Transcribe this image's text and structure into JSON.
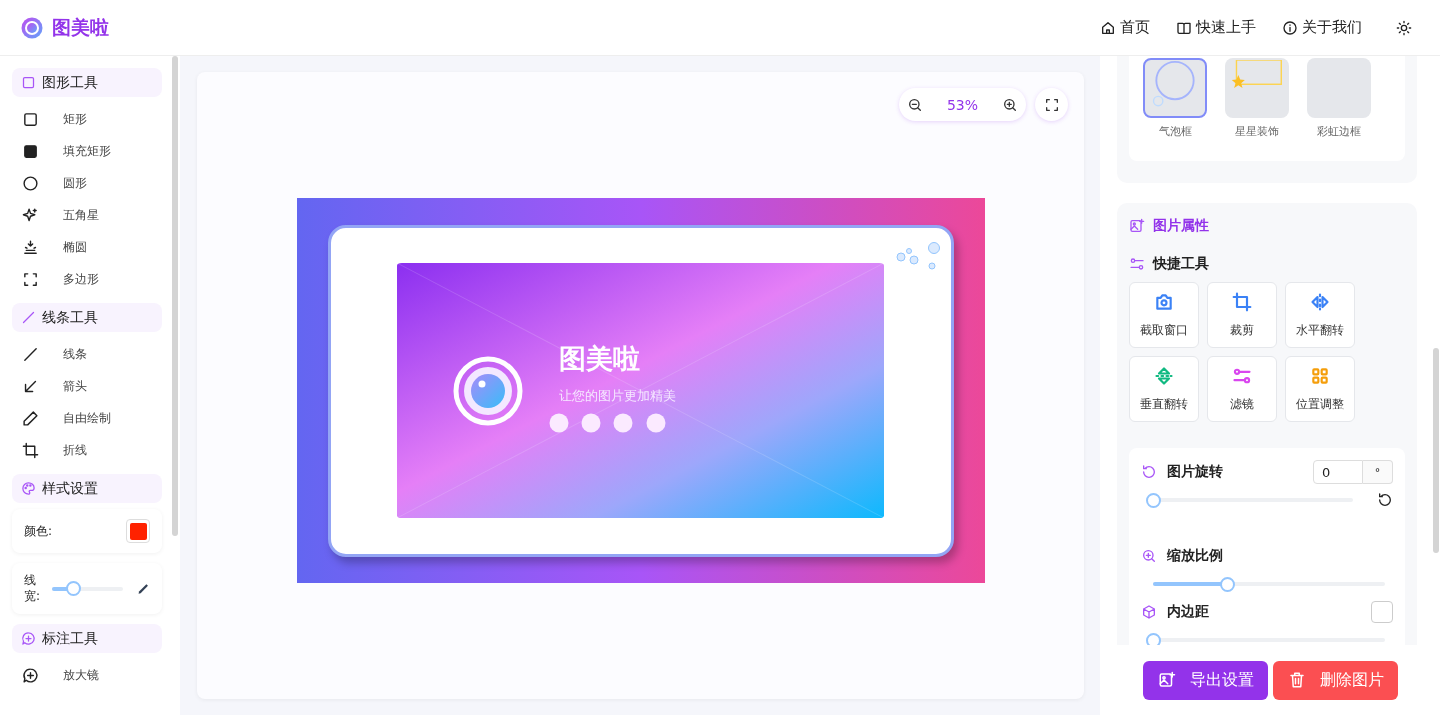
{
  "header": {
    "brand": "图美啦",
    "nav": [
      {
        "label": "首页"
      },
      {
        "label": "快速上手"
      },
      {
        "label": "关于我们"
      }
    ]
  },
  "sidebar": {
    "groups": [
      {
        "title": "图形工具",
        "items": [
          {
            "label": "矩形"
          },
          {
            "label": "填充矩形"
          },
          {
            "label": "圆形"
          },
          {
            "label": "五角星"
          },
          {
            "label": "椭圆"
          },
          {
            "label": "多边形"
          }
        ]
      },
      {
        "title": "线条工具",
        "items": [
          {
            "label": "线条"
          },
          {
            "label": "箭头"
          },
          {
            "label": "自由绘制"
          },
          {
            "label": "折线"
          }
        ]
      },
      {
        "title": "样式设置",
        "color_label": "颜色:",
        "color": "#ff2200",
        "line_width": {
          "label": "线宽:",
          "level": 0.3
        }
      },
      {
        "title": "标注工具",
        "items": [
          {
            "label": "放大镜"
          }
        ]
      }
    ]
  },
  "canvas": {
    "zoom": "53%",
    "image": {
      "title": "图美啦",
      "subtitle": "让您的图片更加精美"
    }
  },
  "panel": {
    "frames": [
      {
        "label": "气泡框",
        "selected": true
      },
      {
        "label": "星星装饰",
        "selected": false
      },
      {
        "label": "彩虹边框",
        "selected": false
      }
    ],
    "properties_title": "图片属性",
    "quick_title": "快捷工具",
    "quick_tools": [
      {
        "label": "截取窗口",
        "color": "#3b82f6"
      },
      {
        "label": "裁剪",
        "color": "#3b82f6"
      },
      {
        "label": "水平翻转",
        "color": "#3b82f6"
      },
      {
        "label": "垂直翻转",
        "color": "#10b981"
      },
      {
        "label": "滤镜",
        "color": "#d946ef"
      },
      {
        "label": "位置调整",
        "color": "#f59e0b"
      }
    ],
    "rotation": {
      "label": "图片旋转",
      "value": "0",
      "unit": "°",
      "level": 0
    },
    "scale": {
      "label": "缩放比例",
      "level": 0.32
    },
    "padding": {
      "label": "内边距",
      "checked": false,
      "level": 0
    },
    "export_button": "导出设置",
    "delete_button": "删除图片"
  }
}
